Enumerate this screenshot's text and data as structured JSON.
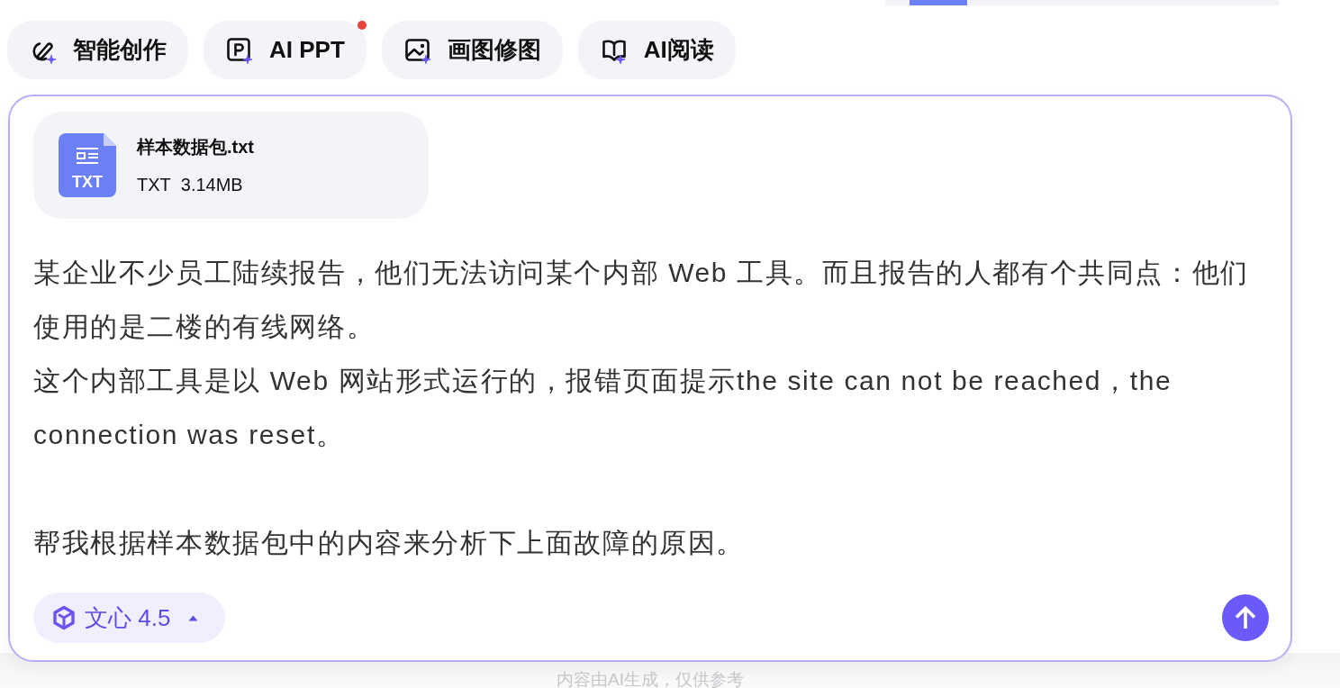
{
  "tools": [
    {
      "label": "智能创作",
      "kind": "write",
      "dot": false
    },
    {
      "label": "AI PPT",
      "kind": "ppt",
      "dot": true
    },
    {
      "label": "画图修图",
      "kind": "image",
      "dot": false
    },
    {
      "label": "AI阅读",
      "kind": "read",
      "dot": false
    }
  ],
  "composer": {
    "attachment": {
      "icon_label": "TXT",
      "name": "样本数据包.txt",
      "type": "TXT",
      "size": "3.14MB"
    },
    "sections": [
      {
        "paragraphs": [
          "某企业不少员工陆续报告，他们无法访问某个内部 Web 工具。而且报告的人都有个共同点：他们使用的是二楼的有线网络。",
          "这个内部工具是以 Web 网站形式运行的，报错页面提示the site can not be reached，the connection was reset。"
        ]
      },
      {
        "paragraphs": [
          "帮我根据样本数据包中的内容来分析下上面故障的原因。"
        ]
      }
    ],
    "model": {
      "label": "文心 4.5"
    }
  },
  "footer": {
    "note": "内容由AI生成，仅供参考"
  }
}
